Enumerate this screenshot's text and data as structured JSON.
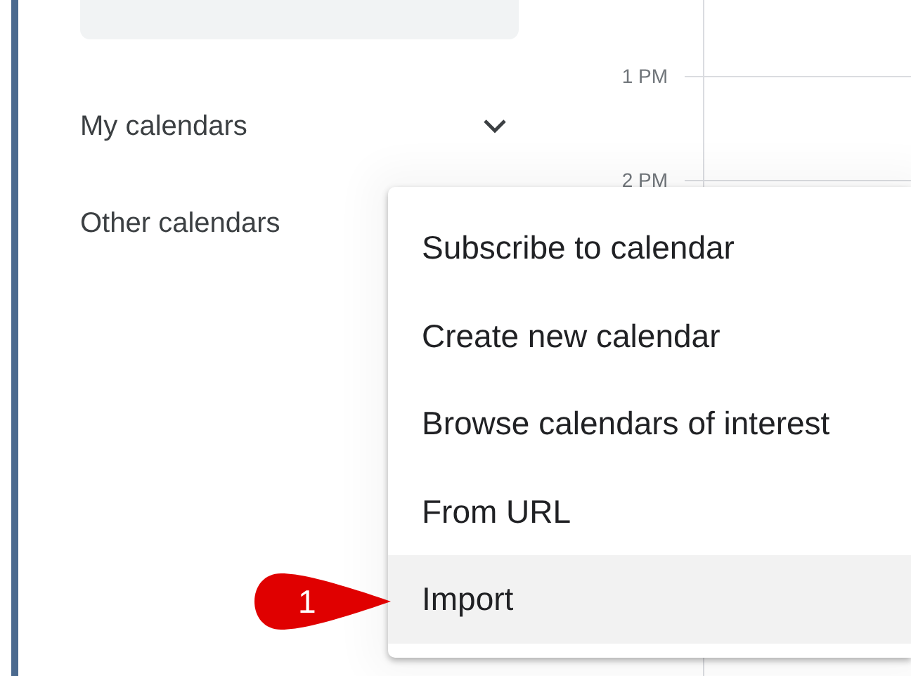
{
  "sidebar": {
    "sections": [
      {
        "label": "My calendars",
        "expanded": true
      },
      {
        "label": "Other calendars"
      }
    ]
  },
  "time_labels": [
    "1 PM",
    "2 PM"
  ],
  "menu": {
    "items": [
      {
        "label": "Subscribe to calendar",
        "selected": false
      },
      {
        "label": "Create new calendar",
        "selected": false
      },
      {
        "label": "Browse calendars of interest",
        "selected": false
      },
      {
        "label": "From URL",
        "selected": false
      },
      {
        "label": "Import",
        "selected": true
      }
    ]
  },
  "callout": {
    "label": "1"
  }
}
